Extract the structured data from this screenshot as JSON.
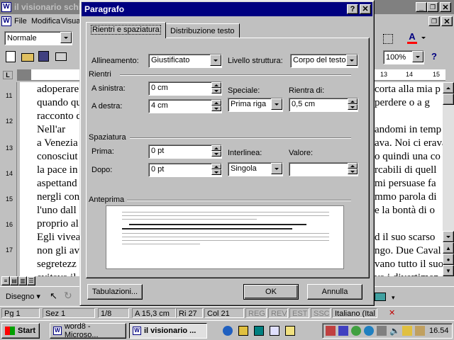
{
  "word": {
    "title": "il visionario schi",
    "menu": [
      "File",
      "Modifica",
      "Visua"
    ],
    "style_value": "Normale",
    "zoom": "100%",
    "document_lines": [
      {
        "left": "adoperare",
        "right": "corta alla mia p"
      },
      {
        "left": "quando qu",
        "right": "perdere o a g"
      },
      {
        "left": "racconto d",
        "right": ""
      },
      {
        "left": "    Nell'ar",
        "right": "andomi in temp"
      },
      {
        "left": "a Venezia",
        "right": "ava. Noi ci erava"
      },
      {
        "left": "conosciut",
        "right": "o quindi una co"
      },
      {
        "left": "la pace in",
        "right": "rcabili di quell"
      },
      {
        "left": "aspettand",
        "right": "mi persuase fa"
      },
      {
        "left": "nergli con",
        "right": "mmo parola di"
      },
      {
        "left": "l'uno dall",
        "right": "e la bontà di o"
      },
      {
        "left": "proprio al",
        "right": ""
      },
      {
        "left": "Egli vivea",
        "right": "d il suo scarso"
      },
      {
        "left": "non gli av",
        "right": "ngo. Due Caval"
      },
      {
        "left": "segretezz",
        "right": "vano tutto il suo"
      },
      {
        "left": "evitava il",
        "right": "va i divertimen"
      }
    ],
    "ruler_numbers": [
      "1",
      "2",
      "3",
      "4",
      "5",
      "6",
      "7",
      "8",
      "9",
      "10",
      "11",
      "12",
      "13",
      "14",
      "15",
      "16",
      "17"
    ],
    "ruler_right": [
      "13",
      "14",
      "15"
    ],
    "draw_label": "Disegno",
    "status": {
      "page": "Pg 1",
      "section": "Sez 1",
      "pages": "1/8",
      "position": "A 15,3 cm",
      "line": "Ri 27",
      "column": "Col 21",
      "rec": "REG",
      "rev": "REV",
      "ext": "EST",
      "ovr": "SSC",
      "language": "Italiano (Ital"
    }
  },
  "taskbar": {
    "start_label": "Start",
    "tasks": [
      "word8 - Microso...",
      "il visionario ..."
    ],
    "clock": "16.54"
  },
  "dialog": {
    "title": "Paragrafo",
    "help_glyph": "?",
    "close_glyph": "✕",
    "tabs": [
      "Rientri e spaziatura",
      "Distribuzione testo"
    ],
    "alignment": {
      "label": "Allineamento:",
      "value": "Giustificato"
    },
    "outline_level": {
      "label": "Livello struttura:",
      "value": "Corpo del testo"
    },
    "indent_group": "Rientri",
    "left_indent": {
      "label": "A sinistra:",
      "value": "0 cm"
    },
    "right_indent": {
      "label": "A destra:",
      "value": "4 cm"
    },
    "special": {
      "label": "Speciale:",
      "value": "Prima riga"
    },
    "by": {
      "label": "Rientra di:",
      "value": "0,5 cm"
    },
    "spacing_group": "Spaziatura",
    "before": {
      "label": "Prima:",
      "value": "0 pt"
    },
    "after": {
      "label": "Dopo:",
      "value": "0 pt"
    },
    "line_spacing": {
      "label": "Interlinea:",
      "value": "Singola"
    },
    "at": {
      "label": "Valore:",
      "value": ""
    },
    "preview_group": "Anteprima",
    "buttons": {
      "tabs": "Tabulazioni...",
      "ok": "OK",
      "cancel": "Annulla"
    }
  }
}
